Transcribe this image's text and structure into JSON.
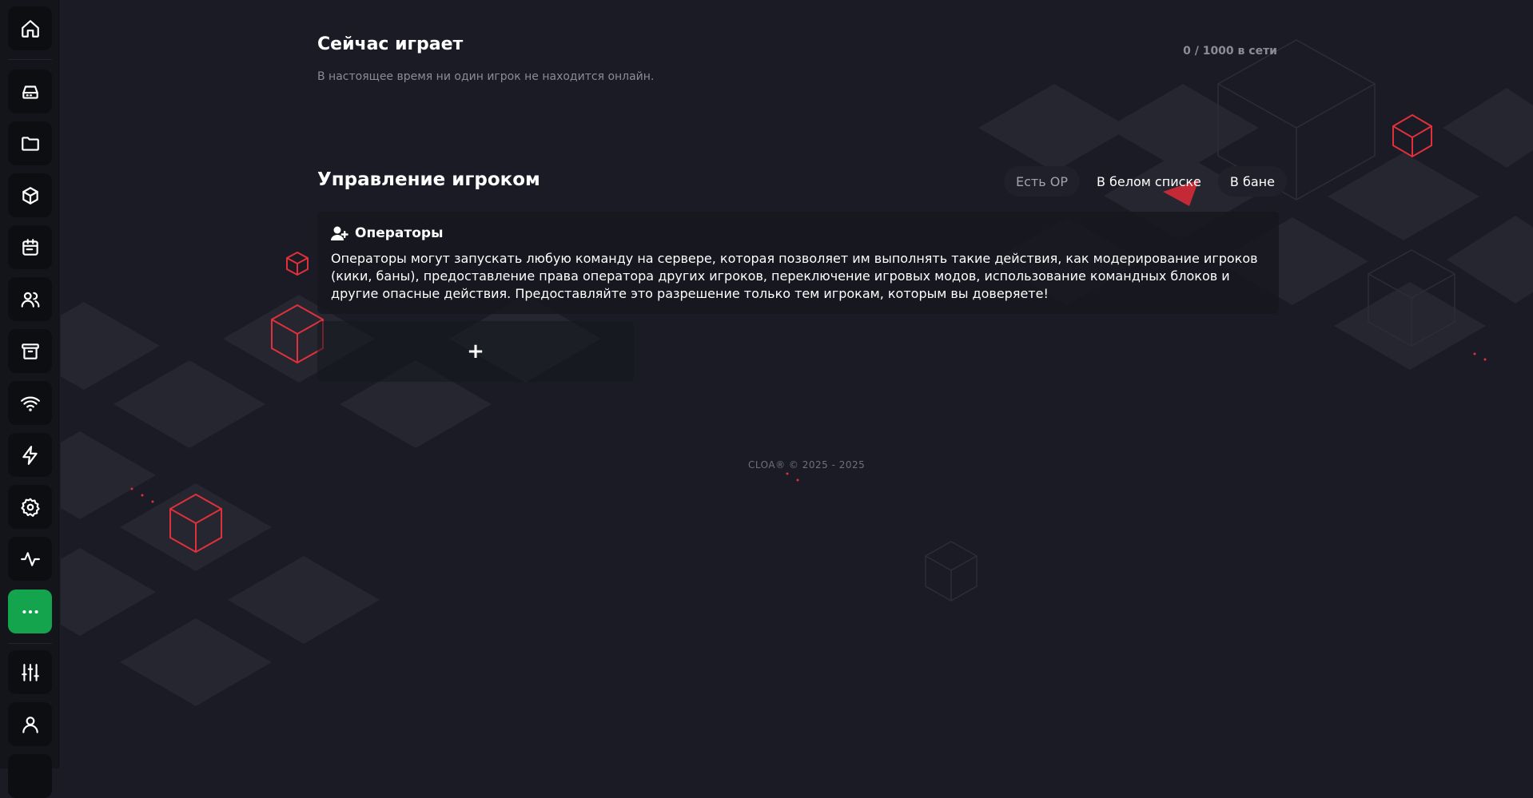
{
  "sidebar": {
    "items": [
      {
        "icon": "home-icon",
        "label": "home"
      },
      {
        "icon": "storage-icon",
        "label": "storage"
      },
      {
        "icon": "folder-icon",
        "label": "files"
      },
      {
        "icon": "cube-icon",
        "label": "plugins"
      },
      {
        "icon": "calendar-icon",
        "label": "schedule"
      },
      {
        "icon": "users-icon",
        "label": "players"
      },
      {
        "icon": "archive-icon",
        "label": "backups"
      },
      {
        "icon": "wifi-icon",
        "label": "network"
      },
      {
        "icon": "lightning-icon",
        "label": "startup"
      },
      {
        "icon": "gear-icon",
        "label": "settings"
      },
      {
        "icon": "activity-icon",
        "label": "activity"
      },
      {
        "icon": "more-icon",
        "label": "more"
      },
      {
        "icon": "sliders-icon",
        "label": "options"
      },
      {
        "icon": "user-icon",
        "label": "account"
      }
    ],
    "active_color": "#14a44d"
  },
  "now_playing": {
    "title": "Сейчас играет",
    "subtitle": "В настоящее время ни один игрок не находится онлайн.",
    "online_count": "0 / 1000 в сети"
  },
  "player_management": {
    "title": "Управление игроком",
    "tabs": [
      {
        "label": "Есть OP"
      },
      {
        "label": "В белом списке"
      },
      {
        "label": "В бане"
      }
    ],
    "card": {
      "title": "Операторы",
      "icon": "user-plus-icon",
      "text": "Операторы могут запускать любую команду на сервере, которая позволяет им выполнять такие действия, как модерирование игроков (кики, баны), предоставление права оператора других игроков, переключение игровых модов, использование командных блоков и другие опасные действия. Предоставляйте это разрешение только тем игрокам, которым вы доверяете!"
    },
    "add_button": "+"
  },
  "footer": "CLOA® © 2025 - 2025",
  "colors": {
    "background": "#1a1b24",
    "accent": "#14a44d",
    "cube_red": "#e0303c",
    "muted": "#8a8c98"
  }
}
